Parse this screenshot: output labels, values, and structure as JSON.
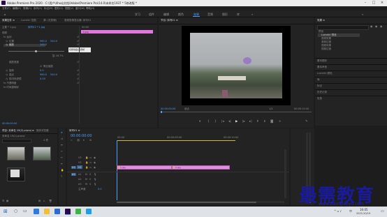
{
  "titlebar": {
    "title": "Adobe Premiere Pro 2020 - C:\\用户\\4hxq\\文档\\Adobe\\Premiere Pro\\14.0\\未命名1937 * 5修改版 *"
  },
  "menu": [
    "文件(F)",
    "编辑(E)",
    "剪辑(C)",
    "序列(S)",
    "标记(M)",
    "图形(G)",
    "视图(V)",
    "窗口(W)",
    "帮助(H)"
  ],
  "workspaces": {
    "items": [
      "学习",
      "组件",
      "编辑",
      "颜色",
      "效果",
      "音频",
      "图形",
      "库"
    ],
    "active": "效果"
  },
  "effect_controls": {
    "tabs": [
      "效果控件 ≡",
      "Lumetri 范围",
      "源: (无剪辑)",
      "音频剪辑混合器: 序列01"
    ],
    "clip_header": "主要 * 1.jpg",
    "seq_header": "序列01 * 1.jpg",
    "clip_bar_label": "1.jpg",
    "time_top": "00:00",
    "section_video": "视频",
    "motion": "fx 运动",
    "position_label": "位置",
    "position_x": "960.0",
    "position_y": "540.0",
    "scale_label": "缩放",
    "scale_value": "100.0",
    "scale_width_label": "缩放宽度",
    "uniform_label": "等比缩放",
    "tooltip": "切换动画/关键帧",
    "rotation_label": "旋转",
    "rotation_value": "0.0",
    "anchor_label": "锚点",
    "anchor_x": "960.0",
    "anchor_y": "540.0",
    "antiflicker_label": "防闪烁滤镜",
    "antiflicker_value": "0.00",
    "opacity": "fx 不透明度",
    "time_remap": "fx 时间重映射",
    "playhead_time": "00:00:00:00",
    "timecode_mid": "复 16.7%"
  },
  "program_monitor": {
    "title": "节目: 序列01 ≡",
    "timecode": "00:00:00:00",
    "fit": "适合",
    "zoom": "1/2",
    "duration": "00:00:10:00"
  },
  "effects_panel": {
    "title": "效果 ≡",
    "tree": [
      "预设",
      "Lumetri 预设",
      "音频效果",
      "音频过渡",
      "视频效果",
      "视频过渡"
    ],
    "sections": [
      "基本图形",
      "基本声音",
      "Lumetri 颜色",
      "库",
      "标记",
      "历史记录",
      "信息"
    ]
  },
  "project_panel": {
    "tabs": [
      "项目: 未命名 19(2).prproj ≡",
      "媒体浏览器"
    ],
    "path": "未命名 19(2).prproj",
    "items_count": "4 项"
  },
  "timeline": {
    "title": "序列01 ≡",
    "timecode": "00:00:00:00",
    "ruler": [
      "00:00",
      "00:00:05:00",
      "00:00:10:00"
    ],
    "video_tracks": [
      "V3",
      "V2",
      "V1"
    ],
    "audio_tracks": [
      "A1",
      "A2",
      "A3"
    ],
    "master": "主声道",
    "master_value": "0.0",
    "clips": [
      {
        "label": "1.jpg"
      },
      {
        "label": "2.jpg"
      }
    ]
  },
  "taskbar": {
    "time": "16:05",
    "date": "2021/10/19",
    "lang": "中"
  },
  "watermark": {
    "text": "最需教育",
    "sub": "www.zuixujiaoyu.com"
  },
  "colors": {
    "accent": "#4d9eff",
    "clip": "#e28ee0",
    "playhead": "#4d9eff",
    "workarea": "#d0c000"
  }
}
